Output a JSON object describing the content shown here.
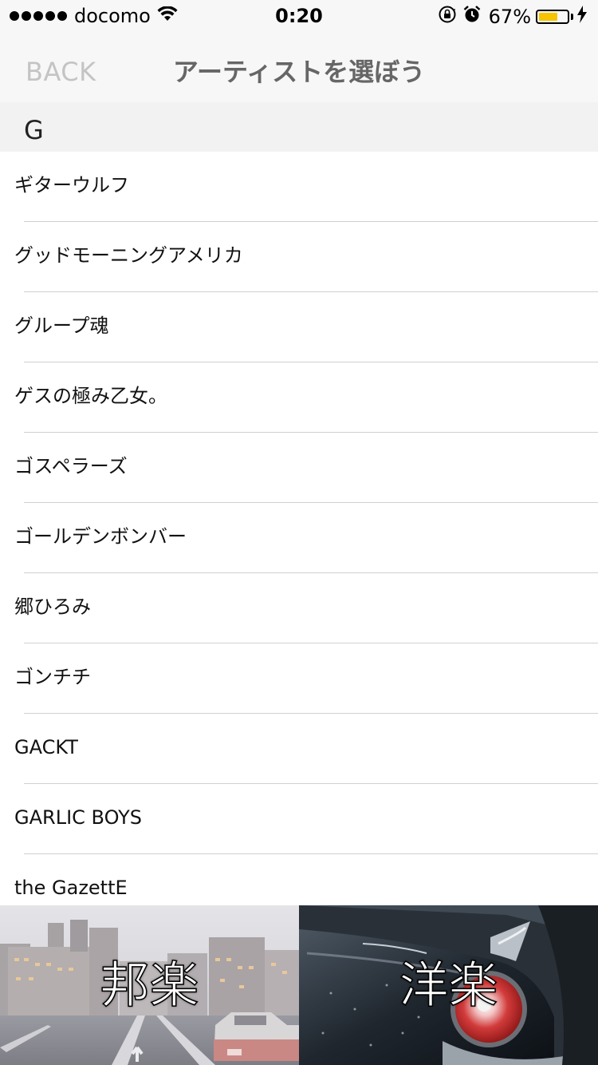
{
  "status_bar": {
    "carrier": "docomo",
    "time": "0:20",
    "battery_percent": "67%",
    "battery_level": 0.67,
    "signal_bars": 5
  },
  "nav": {
    "back_label": "BACK",
    "title": "アーティストを選ぼう"
  },
  "section": {
    "letter": "G"
  },
  "artists": [
    "ギターウルフ",
    "グッドモーニングアメリカ",
    "グループ魂",
    "ゲスの極み乙女。",
    "ゴスペラーズ",
    "ゴールデンボンバー",
    "郷ひろみ",
    "ゴンチチ",
    "GACKT",
    "GARLIC BOYS",
    "the GazettE"
  ],
  "tabs": {
    "domestic_label": "邦楽",
    "western_label": "洋楽"
  },
  "colors": {
    "battery": "#f6c400",
    "back_inactive": "#c4c4c4",
    "title": "#666666",
    "section_bg": "#f2f2f2"
  }
}
